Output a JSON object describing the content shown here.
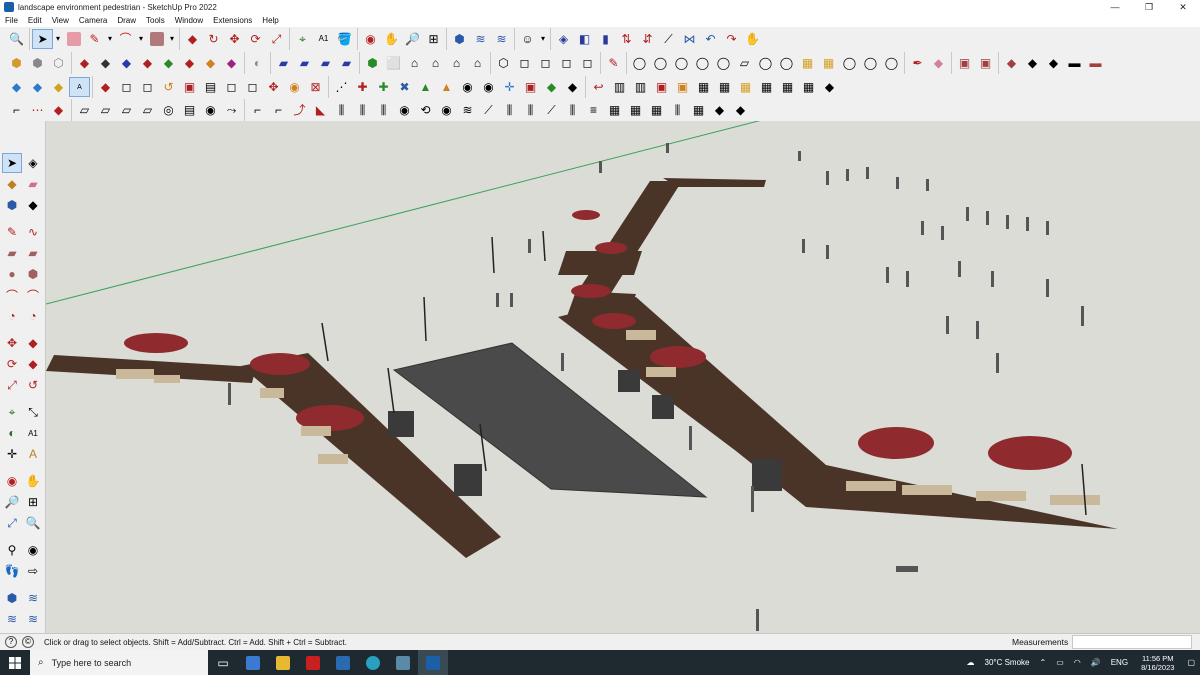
{
  "window": {
    "title": "landscape environment pedestrian - SketchUp Pro 2022",
    "controls": [
      "—",
      "❐",
      "✕"
    ]
  },
  "menu": [
    "File",
    "Edit",
    "View",
    "Camera",
    "Draw",
    "Tools",
    "Window",
    "Extensions",
    "Help"
  ],
  "statusbar": {
    "hint": "Click or drag to select objects. Shift = Add/Subtract. Ctrl = Add. Shift + Ctrl = Subtract.",
    "measurements_label": "Measurements",
    "measurements_value": ""
  },
  "taskbar": {
    "search_placeholder": "Type here to search",
    "weather": "30°C  Smoke",
    "language": "ENG",
    "time": "11:56 PM",
    "date": "8/16/2023"
  },
  "colors": {
    "deck": "#4a3427",
    "umbrella": "#8f2a2e",
    "paving": "#4a4a4a",
    "ground": "#dcdcd6",
    "axis_green": "#3aa15a"
  }
}
